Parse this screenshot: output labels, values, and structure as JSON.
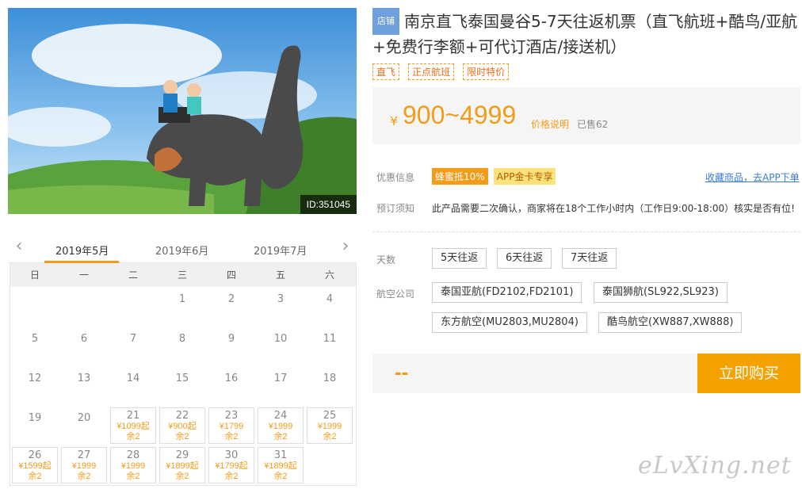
{
  "hero": {
    "id_label": "ID:351045"
  },
  "calendar": {
    "prev_icon": "chevron-left-icon",
    "next_icon": "chevron-right-icon",
    "months": [
      "2019年5月",
      "2019年6月",
      "2019年7月"
    ],
    "active_month": "2019年5月",
    "weekdays": [
      "日",
      "一",
      "二",
      "三",
      "四",
      "五",
      "六"
    ],
    "days": [
      {
        "day": ""
      },
      {
        "day": ""
      },
      {
        "day": ""
      },
      {
        "day": "1"
      },
      {
        "day": "2"
      },
      {
        "day": "3"
      },
      {
        "day": "4"
      },
      {
        "day": "5"
      },
      {
        "day": "6"
      },
      {
        "day": "7"
      },
      {
        "day": "8"
      },
      {
        "day": "9"
      },
      {
        "day": "10"
      },
      {
        "day": "11"
      },
      {
        "day": "12"
      },
      {
        "day": "13"
      },
      {
        "day": "14"
      },
      {
        "day": "15"
      },
      {
        "day": "16"
      },
      {
        "day": "17"
      },
      {
        "day": "18"
      },
      {
        "day": "19"
      },
      {
        "day": "20"
      },
      {
        "day": "21",
        "price": "¥1099起",
        "stock": "余2"
      },
      {
        "day": "22",
        "price": "¥900起",
        "stock": "余2"
      },
      {
        "day": "23",
        "price": "¥1799",
        "stock": "余2"
      },
      {
        "day": "24",
        "price": "¥1999",
        "stock": "余2"
      },
      {
        "day": "25",
        "price": "¥1999",
        "stock": "余2"
      },
      {
        "day": "26",
        "price": "¥1599起",
        "stock": "余2"
      },
      {
        "day": "27",
        "price": "¥1999",
        "stock": "余2"
      },
      {
        "day": "28",
        "price": "¥1999",
        "stock": "余2"
      },
      {
        "day": "29",
        "price": "¥1899起",
        "stock": "余2"
      },
      {
        "day": "30",
        "price": "¥1799起",
        "stock": "余2"
      },
      {
        "day": "31",
        "price": "¥1899起",
        "stock": "余2"
      }
    ]
  },
  "product": {
    "shop_badge": "店铺",
    "title": "南京直飞泰国曼谷5-7天往返机票（直飞航班+酷鸟/亚航+免费行李额+可代订酒店/接送机）",
    "tags": [
      "直飞",
      "正点航班",
      "限时特价"
    ],
    "price_symbol": "¥",
    "price": "900~4999",
    "price_note": "价格说明",
    "sold": "已售62"
  },
  "promo": {
    "label": "优惠信息",
    "items": [
      "蜂蜜抵10%",
      "APP金卡专享"
    ],
    "fav_link": "收藏商品，去APP下单"
  },
  "notice": {
    "label": "预订须知",
    "text": "此产品需要二次确认，商家将在18个工作小时内（工作日9:00-18:00）核实是否有位!"
  },
  "days_option": {
    "label": "天数",
    "options": [
      "5天往返",
      "6天往返",
      "7天往返"
    ]
  },
  "airline_option": {
    "label": "航空公司",
    "options": [
      "泰国亚航(FD2102,FD2101)",
      "泰国狮航(SL922,SL923)",
      "东方航空(MU2803,MU2804)",
      "酷鸟航空(XW887,XW888)"
    ]
  },
  "buy": {
    "total": "--",
    "button": "立即购买"
  },
  "watermark": "eLvXing.net",
  "colors": {
    "accent": "#f39c1a",
    "button": "#f5a100",
    "link": "#3a7bd5",
    "badge": "#6ea0de"
  }
}
